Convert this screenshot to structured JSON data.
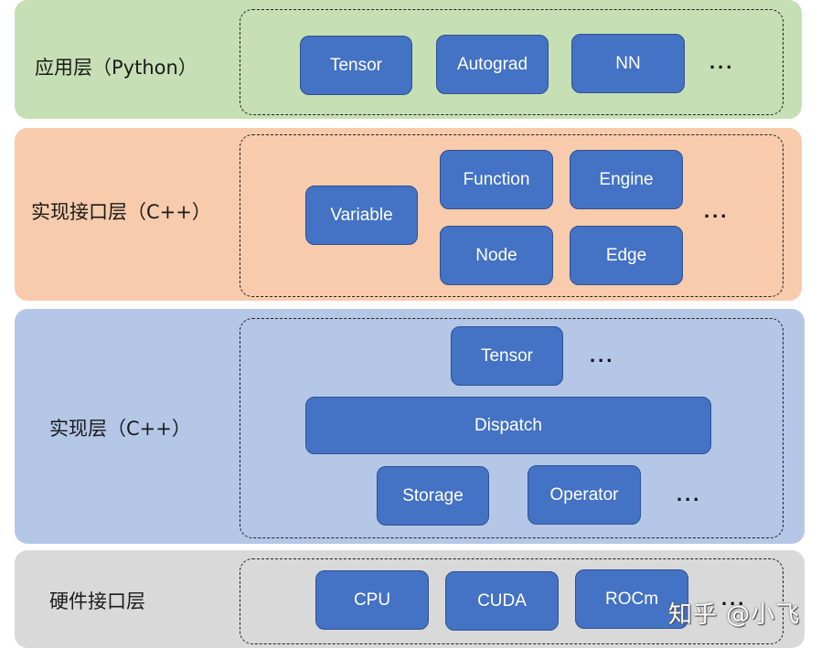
{
  "layers": {
    "app": {
      "title": "应用层（Python）",
      "color": "#c6dfb4",
      "components": [
        "Tensor",
        "Autograd",
        "NN"
      ],
      "ellipsis": "..."
    },
    "iface": {
      "title": "实现接口层（C++）",
      "color": "#f7cbac",
      "components": [
        "Variable",
        "Function",
        "Engine",
        "Node",
        "Edge"
      ],
      "ellipsis": "..."
    },
    "impl": {
      "title": "实现层（C++）",
      "color": "#b4c7e7",
      "components": [
        "Tensor",
        "Dispatch",
        "Storage",
        "Operator"
      ],
      "ellipsis_top": "...",
      "ellipsis_bottom": "..."
    },
    "hw": {
      "title": "硬件接口层",
      "color": "#d9d9d9",
      "components": [
        "CPU",
        "CUDA",
        "ROCm"
      ],
      "ellipsis": "..."
    }
  },
  "box_color": "#4472c4",
  "watermark": "知乎 @小飞"
}
